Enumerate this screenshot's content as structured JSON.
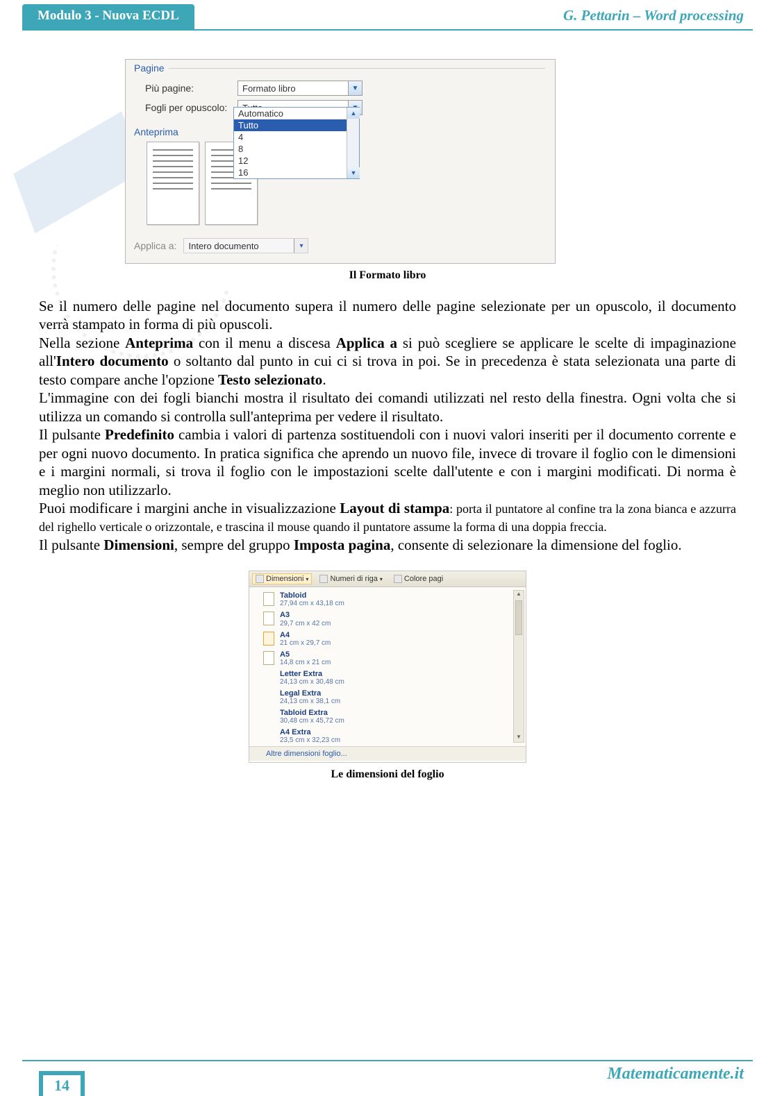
{
  "header": {
    "tab": "Modulo 3 - Nuova ECDL",
    "right": "G. Pettarin – Word processing"
  },
  "screenshot1": {
    "group_pagine": "Pagine",
    "piu_pagine_label": "Più pagine:",
    "piu_pagine_value": "Formato libro",
    "fogli_label": "Fogli per opuscolo:",
    "fogli_value": "Tutto",
    "dropdown": {
      "opt_auto": "Automatico",
      "opt_tutto": "Tutto",
      "opt_4": "4",
      "opt_8": "8",
      "opt_12": "12",
      "opt_16": "16"
    },
    "anteprima_label": "Anteprima",
    "applica_label": "Applica a:",
    "applica_value": "Intero documento",
    "caption": "Il Formato libro"
  },
  "body": {
    "p1a": "Se il numero delle pagine nel documento supera il numero delle pagine selezionate per un opuscolo, il documento verrà stampato in forma di più opuscoli.",
    "p2a": "Nella sezione ",
    "p2b": "Anteprima",
    "p2c": " con il menu a discesa ",
    "p2d": "Applica a",
    "p2e": " si può scegliere se applicare le scelte di impaginazione all'",
    "p2f": "Intero documento",
    "p2g": " o soltanto dal punto in cui ci si trova in poi. Se in precedenza è stata selezionata una parte di testo compare anche l'opzione ",
    "p2h": "Testo selezionato",
    "p2i": ".",
    "p3": "L'immagine con dei fogli bianchi mostra il risultato dei comandi utilizzati nel resto della finestra. Ogni volta che si utilizza un comando si controlla sull'anteprima per vedere il risultato.",
    "p4a": "Il pulsante ",
    "p4b": "Predefinito",
    "p4c": " cambia i valori di partenza sostituendoli con i nuovi valori inseriti per il documento corrente e per ogni nuovo documento. In pratica significa che aprendo un nuovo file, invece di trovare il foglio con le dimensioni e i margini normali, si trova il foglio con le impostazioni scelte dall'utente e con i margini modificati. Di norma è meglio non utilizzarlo.",
    "p5a": "Puoi modificare i margini anche in visualizzazione ",
    "p5b": "Layout di stampa",
    "p5c": ": porta il puntatore al confine tra la zona bianca e azzurra del righello verticale o orizzontale, e trascina il mouse quando il puntatore assume la forma di una doppia freccia.",
    "p6a": "Il pulsante ",
    "p6b": "Dimensioni",
    "p6c": ", sempre del gruppo ",
    "p6d": "Imposta pagina",
    "p6e": ", consente di selezionare la dimensione del foglio."
  },
  "screenshot2": {
    "ribbon_dim": "Dimensioni",
    "ribbon_num": "Numeri di riga",
    "ribbon_col": "Colore pagi",
    "items": {
      "tabloid_name": "Tabloid",
      "tabloid_dim": "27,94 cm x 43,18 cm",
      "a3_name": "A3",
      "a3_dim": "29,7 cm x 42 cm",
      "a4_name": "A4",
      "a4_dim": "21 cm x 29,7 cm",
      "a5_name": "A5",
      "a5_dim": "14,8 cm x 21 cm",
      "letx_name": "Letter Extra",
      "letx_dim": "24,13 cm x 30,48 cm",
      "legx_name": "Legal Extra",
      "legx_dim": "24,13 cm x 38,1 cm",
      "tabx_name": "Tabloid Extra",
      "tabx_dim": "30,48 cm x 45,72 cm",
      "a4x_name": "A4 Extra",
      "a4x_dim": "23,5 cm x 32,23 cm"
    },
    "footer_link": "Altre dimensioni foglio...",
    "caption": "Le dimensioni del foglio"
  },
  "footer": {
    "page": "14",
    "brand": "Matematicamente.it"
  }
}
